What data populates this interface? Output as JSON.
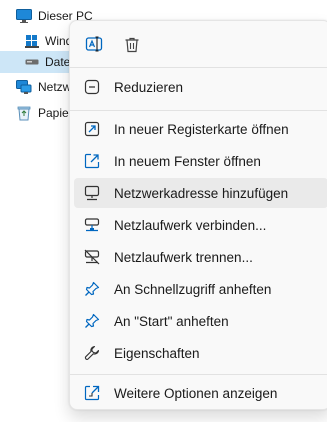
{
  "tree": {
    "items": [
      {
        "label": "Dieser PC",
        "icon": "monitor-icon"
      },
      {
        "label": "Windows (C:)",
        "icon": "windows-drive-icon"
      },
      {
        "label": "Daten (D:)",
        "icon": "drive-icon"
      },
      {
        "label": "Netzwerk",
        "icon": "network-icon"
      },
      {
        "label": "Papierkorb",
        "icon": "recycle-bin-icon"
      }
    ]
  },
  "menu": {
    "quick_actions": [
      {
        "name": "rename",
        "icon": "rename-icon"
      },
      {
        "name": "delete",
        "icon": "trash-icon"
      }
    ],
    "items": [
      {
        "label": "Reduzieren",
        "icon": "collapse-icon"
      },
      {
        "label": "In neuer Registerkarte öffnen",
        "icon": "open-new-tab-icon"
      },
      {
        "label": "In neuem Fenster öffnen",
        "icon": "open-new-window-icon"
      },
      {
        "label": "Netzwerkadresse hinzufügen",
        "icon": "add-network-location-icon"
      },
      {
        "label": "Netzlaufwerk verbinden...",
        "icon": "map-network-drive-icon"
      },
      {
        "label": "Netzlaufwerk trennen...",
        "icon": "disconnect-network-drive-icon"
      },
      {
        "label": "An Schnellzugriff anheften",
        "icon": "pin-icon"
      },
      {
        "label": "An \"Start\" anheften",
        "icon": "pin-start-icon"
      },
      {
        "label": "Eigenschaften",
        "icon": "wrench-icon"
      },
      {
        "label": "Weitere Optionen anzeigen",
        "icon": "more-options-icon"
      }
    ]
  },
  "colors": {
    "accent": "#0067c0",
    "selection": "#cde6f7",
    "menu_background": "#f9f9f9",
    "hover": "#eaeaea"
  }
}
